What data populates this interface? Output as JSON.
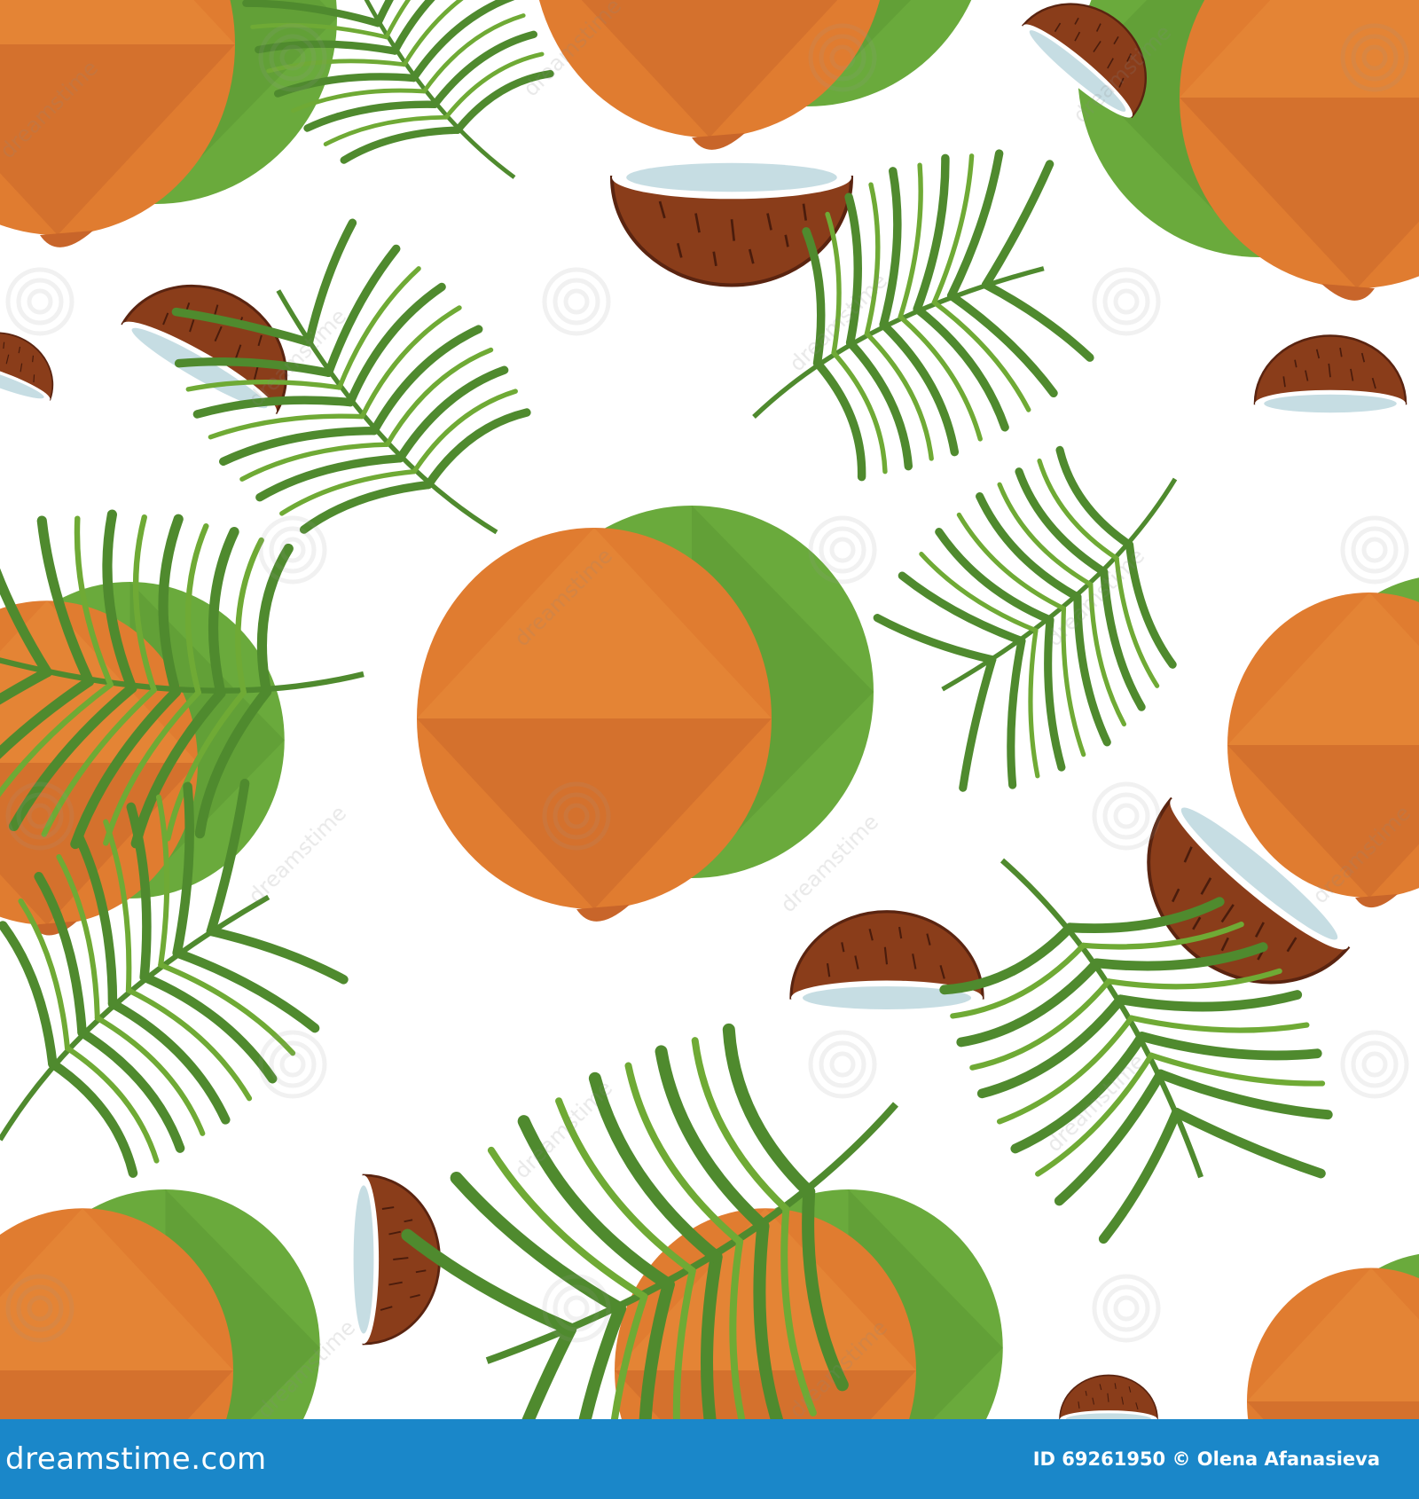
{
  "footer": {
    "logo_text": "dreamstime.com",
    "credit_text": "ID 69261950 © Olena Afanasieva",
    "background_color": "#1a87c9"
  },
  "watermark": {
    "text": "dreamstime"
  },
  "colors": {
    "coconut_orange": "#e07c30",
    "coconut_green": "#6aaa3c",
    "husk_brown": "#8a3d1a",
    "flesh_blue": "#c6dde3",
    "frond_green": "#4f8a2e",
    "background": "#ffffff"
  }
}
